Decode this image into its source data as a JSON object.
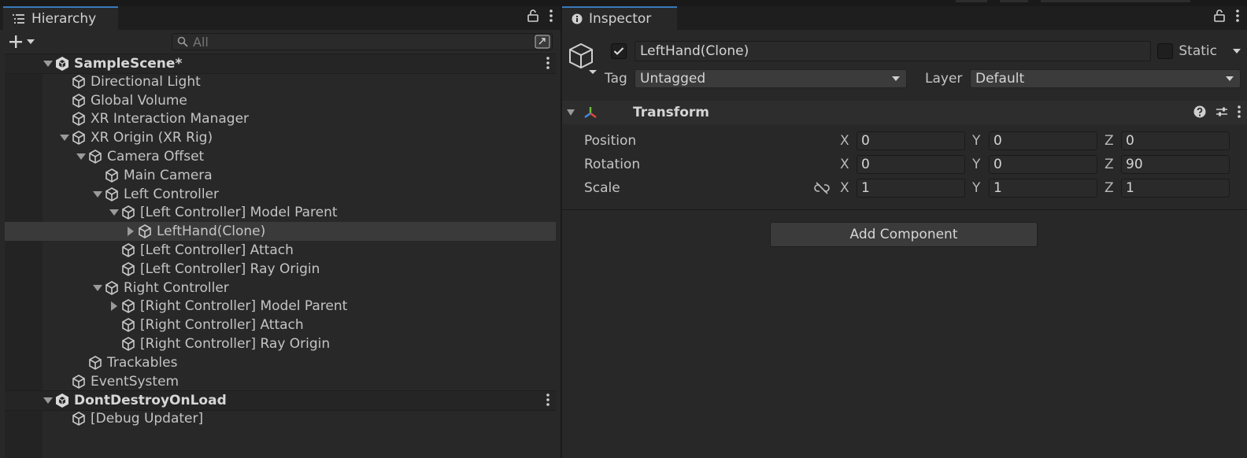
{
  "hierarchy": {
    "tab_label": "Hierarchy",
    "search_placeholder": "All",
    "rows": [
      {
        "label": "SampleScene*",
        "depth": 0,
        "arrow": "down",
        "icon": "unity-scene-icon",
        "scene": true
      },
      {
        "label": "Directional Light",
        "depth": 1,
        "arrow": "none",
        "icon": "gameobject-cube-icon"
      },
      {
        "label": "Global Volume",
        "depth": 1,
        "arrow": "none",
        "icon": "gameobject-cube-icon"
      },
      {
        "label": "XR Interaction Manager",
        "depth": 1,
        "arrow": "none",
        "icon": "gameobject-cube-icon"
      },
      {
        "label": "XR Origin (XR Rig)",
        "depth": 1,
        "arrow": "down",
        "icon": "gameobject-cube-icon"
      },
      {
        "label": "Camera Offset",
        "depth": 2,
        "arrow": "down",
        "icon": "gameobject-cube-icon"
      },
      {
        "label": "Main Camera",
        "depth": 3,
        "arrow": "none",
        "icon": "gameobject-cube-icon"
      },
      {
        "label": "Left Controller",
        "depth": 3,
        "arrow": "down",
        "icon": "gameobject-cube-icon"
      },
      {
        "label": "[Left Controller] Model Parent",
        "depth": 4,
        "arrow": "down",
        "icon": "gameobject-cube-icon"
      },
      {
        "label": "LeftHand(Clone)",
        "depth": 5,
        "arrow": "right",
        "icon": "gameobject-cube-icon",
        "selected": true
      },
      {
        "label": "[Left Controller] Attach",
        "depth": 4,
        "arrow": "none",
        "icon": "gameobject-cube-icon"
      },
      {
        "label": "[Left Controller] Ray Origin",
        "depth": 4,
        "arrow": "none",
        "icon": "gameobject-cube-icon"
      },
      {
        "label": "Right Controller",
        "depth": 3,
        "arrow": "down",
        "icon": "gameobject-cube-icon"
      },
      {
        "label": "[Right Controller] Model Parent",
        "depth": 4,
        "arrow": "right",
        "icon": "gameobject-cube-icon"
      },
      {
        "label": "[Right Controller] Attach",
        "depth": 4,
        "arrow": "none",
        "icon": "gameobject-cube-icon"
      },
      {
        "label": "[Right Controller] Ray Origin",
        "depth": 4,
        "arrow": "none",
        "icon": "gameobject-cube-icon"
      },
      {
        "label": "Trackables",
        "depth": 2,
        "arrow": "none",
        "icon": "gameobject-cube-icon"
      },
      {
        "label": "EventSystem",
        "depth": 1,
        "arrow": "none",
        "icon": "gameobject-cube-icon"
      },
      {
        "label": "DontDestroyOnLoad",
        "depth": 0,
        "arrow": "down",
        "icon": "unity-scene-icon",
        "scene": true
      },
      {
        "label": "[Debug Updater]",
        "depth": 1,
        "arrow": "none",
        "icon": "gameobject-cube-icon"
      }
    ]
  },
  "inspector": {
    "tab_label": "Inspector",
    "object_name": "LeftHand(Clone)",
    "static_label": "Static",
    "tag_label": "Tag",
    "tag_value": "Untagged",
    "layer_label": "Layer",
    "layer_value": "Default",
    "component_title": "Transform",
    "position": {
      "label": "Position",
      "x": "0",
      "y": "0",
      "z": "0"
    },
    "rotation": {
      "label": "Rotation",
      "x": "0",
      "y": "0",
      "z": "90"
    },
    "scale": {
      "label": "Scale",
      "x": "1",
      "y": "1",
      "z": "1"
    },
    "axis_x": "X",
    "axis_y": "Y",
    "axis_z": "Z",
    "add_component_label": "Add Component"
  },
  "colors": {
    "panel_bg": "#282828",
    "tab_accent": "#3a79bb",
    "selected_row": "#3a3a3a",
    "text": "#c4c4c4"
  }
}
